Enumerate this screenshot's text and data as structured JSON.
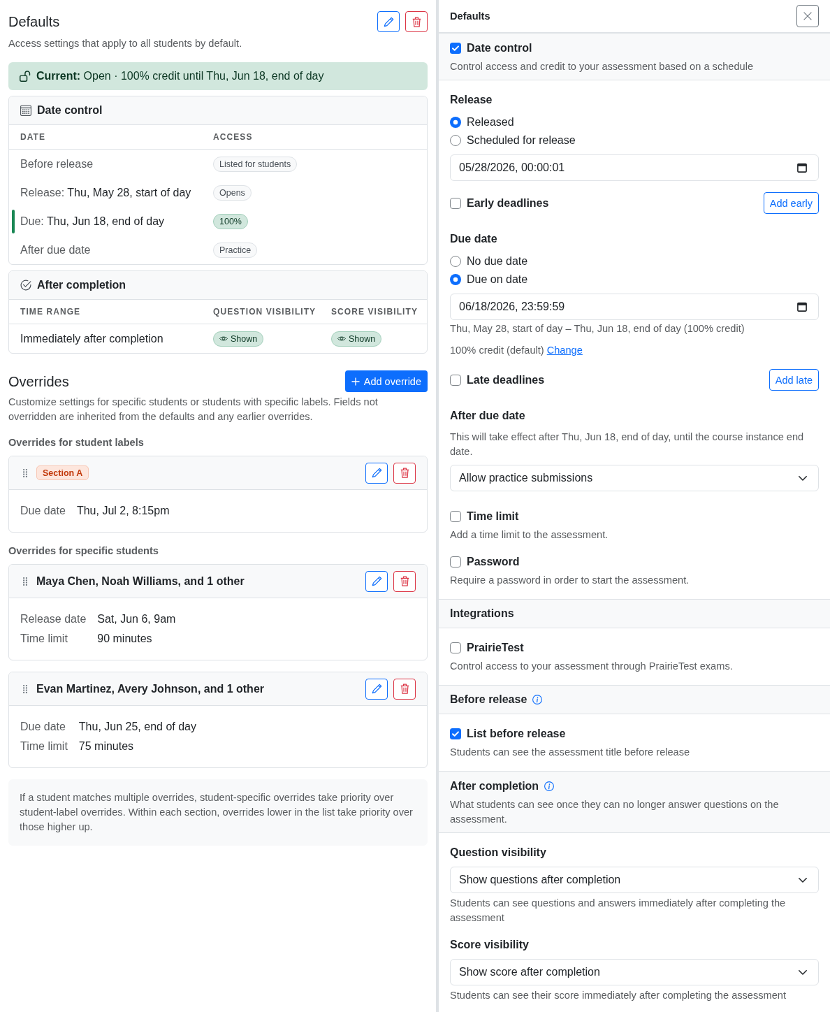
{
  "defaults": {
    "title": "Defaults",
    "description": "Access settings that apply to all students by default.",
    "current": "**Current:** Open · 100% credit until Thu, Jun 18, end of day",
    "tables": [
      {
        "kind": "date_control",
        "title": "Date control",
        "columns": [
          "DATE",
          "ACCESS"
        ],
        "rows": [
          {
            "current": false,
            "cells": [
              {
                "kind": "text",
                "label": "Before release"
              },
              {
                "kind": "neutral",
                "text": "Listed for students"
              }
            ]
          },
          {
            "current": false,
            "cells": [
              {
                "kind": "text",
                "label": "Release:",
                "value": "Thu, May 28, start of day"
              },
              {
                "kind": "neutral",
                "text": "Opens"
              }
            ]
          },
          {
            "current": true,
            "cells": [
              {
                "kind": "text",
                "label": "Due:",
                "value": "Thu, Jun 18, end of day"
              },
              {
                "kind": "success",
                "text": "100%"
              }
            ]
          },
          {
            "current": false,
            "cells": [
              {
                "kind": "text",
                "label": "After due date"
              },
              {
                "kind": "neutral",
                "text": "Practice"
              }
            ]
          }
        ]
      },
      {
        "kind": "after_completion",
        "title": "After completion",
        "columns": [
          "TIME RANGE",
          "QUESTION VISIBILITY",
          "SCORE VISIBILITY"
        ],
        "rows": [
          {
            "cells": [
              {
                "kind": "text",
                "value": "Immediately after completion"
              },
              {
                "kind": "shown",
                "text": "Shown"
              },
              {
                "kind": "shown",
                "text": "Shown"
              }
            ]
          }
        ]
      }
    ]
  },
  "overrides": {
    "title": "Overrides",
    "add_button": "Add override",
    "description": "Customize settings for specific students or students with specific labels. Fields not overridden are inherited from the defaults and any earlier overrides.",
    "groups": [
      {
        "heading": "Overrides for student labels",
        "items": [
          {
            "kind": "label",
            "title": "Section A",
            "fields": [
              {
                "label": "Due date",
                "value": "Thu, Jul 2, 8:15pm"
              }
            ]
          }
        ]
      },
      {
        "heading": "Overrides for specific students",
        "items": [
          {
            "kind": "students",
            "title": "Maya Chen, Noah Williams, and 1 other",
            "fields": [
              {
                "label": "Release date",
                "value": "Sat, Jun 6, 9am"
              },
              {
                "label": "Time limit",
                "value": "90 minutes"
              }
            ]
          },
          {
            "kind": "students",
            "title": "Evan Martinez, Avery Johnson, and 1 other",
            "fields": [
              {
                "label": "Due date",
                "value": "Thu, Jun 25, end of day"
              },
              {
                "label": "Time limit",
                "value": "75 minutes"
              }
            ]
          }
        ]
      }
    ],
    "note": "If a student matches multiple overrides, student-specific overrides take priority over student-label overrides. Within each section, overrides lower in the list take priority over those higher up."
  },
  "panel": {
    "title": "Defaults",
    "sections": [
      {
        "kind": "toggle_header",
        "label": "Date control",
        "checked": true,
        "description": "Control access and credit to your assessment based on a schedule"
      },
      {
        "kind": "body",
        "items": [
          {
            "kind": "radio_group",
            "heading": "Release",
            "options": [
              {
                "label": "Released",
                "selected": true
              },
              {
                "label": "Scheduled for release",
                "selected": false
              }
            ],
            "date_input": {
              "value": "05/28/2026, 00:00:01"
            }
          },
          {
            "kind": "check_action",
            "label": "Early deadlines",
            "checked": false,
            "button": "Add early"
          },
          {
            "kind": "radio_group",
            "heading": "Due date",
            "options": [
              {
                "label": "No due date",
                "selected": false
              },
              {
                "label": "Due on date",
                "selected": true
              }
            ],
            "date_input": {
              "value": "06/18/2026, 23:59:59"
            },
            "range_note": "Thu, May 28, start of day – Thu, Jun 18, end of day (100% credit)",
            "credit": {
              "text": "100% credit (default)",
              "link": "Change"
            }
          },
          {
            "kind": "check_action",
            "label": "Late deadlines",
            "checked": false,
            "button": "Add late"
          },
          {
            "kind": "select",
            "heading": "After due date",
            "description": "This will take effect after Thu, Jun 18, end of day, until the course instance end date.",
            "value": "Allow practice submissions"
          },
          {
            "kind": "check",
            "label": "Time limit",
            "checked": false,
            "description": "Add a time limit to the assessment."
          },
          {
            "kind": "check",
            "label": "Password",
            "checked": false,
            "description": "Require a password in order to start the assessment."
          }
        ]
      },
      {
        "kind": "header",
        "title": "Integrations"
      },
      {
        "kind": "body",
        "items": [
          {
            "kind": "check",
            "label": "PrairieTest",
            "checked": false,
            "description": "Control access to your assessment through PrairieTest exams."
          }
        ]
      },
      {
        "kind": "header",
        "title": "Before release",
        "info": true
      },
      {
        "kind": "body",
        "items": [
          {
            "kind": "check",
            "label": "List before release",
            "checked": true,
            "description": "Students can see the assessment title before release"
          }
        ]
      },
      {
        "kind": "header",
        "title": "After completion",
        "info": true,
        "description": "What students can see once they can no longer answer questions on the assessment."
      },
      {
        "kind": "body",
        "items": [
          {
            "kind": "select",
            "heading": "Question visibility",
            "value": "Show questions after completion",
            "hint": "Students can see questions and answers immediately after completing the assessment"
          },
          {
            "kind": "select",
            "heading": "Score visibility",
            "value": "Show score after completion",
            "hint": "Students can see their score immediately after completing the assessment"
          }
        ]
      }
    ]
  }
}
